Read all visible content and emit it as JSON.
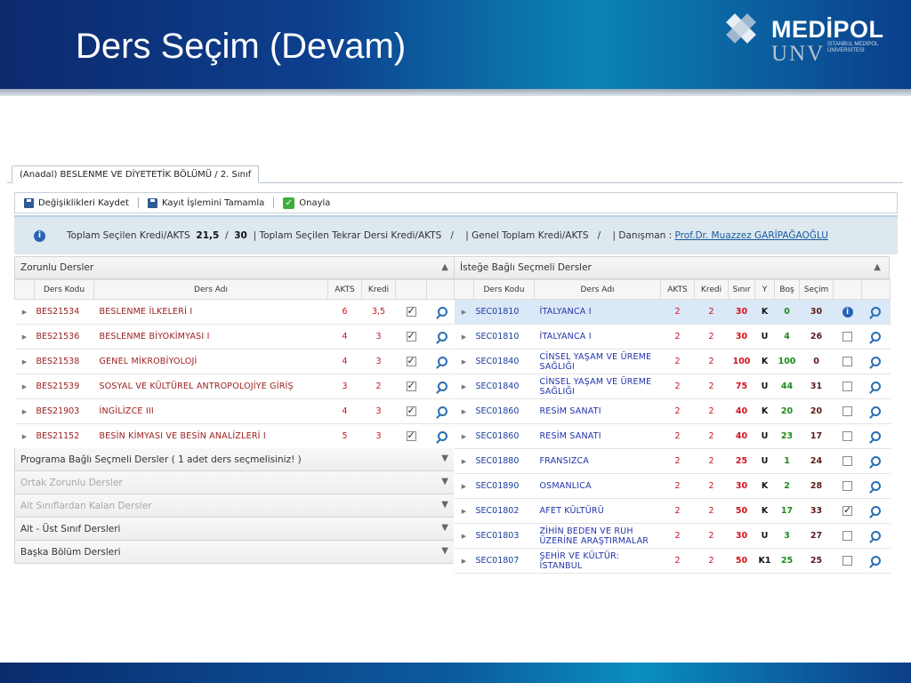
{
  "slide": {
    "title": "Ders Seçim (Devam)",
    "logo": {
      "name": "MEDİPOL",
      "unv": "UNV",
      "sub": "İSTANBUL MEDİPOL ÜNİVERSİTESİ"
    }
  },
  "app": {
    "tab_label": "(Anadal) BESLENME VE DİYETETİK BÖLÜMÜ / 2. Sınıf",
    "toolbar": {
      "save_label": "Değişiklikleri Kaydet",
      "complete_label": "Kayıt İşlemini Tamamla",
      "approve_label": "Onayla"
    },
    "info": {
      "total_label": "Toplam Seçilen Kredi/AKTS",
      "total_value": "21,5",
      "total_sep": "/",
      "total_max": "30",
      "repeat_label": "| Toplam Seçilen Tekrar Dersi Kredi/AKTS",
      "repeat_value": "/",
      "general_label": "| Genel Toplam Kredi/AKTS",
      "general_value": "/",
      "advisor_label": "| Danışman :",
      "advisor_name": "Prof.Dr. Muazzez GARİPAĞAOĞLU"
    },
    "mandatory": {
      "title": "Zorunlu Dersler",
      "headers": {
        "code": "Ders Kodu",
        "name": "Ders Adı",
        "akts": "AKTS",
        "kredi": "Kredi"
      },
      "rows": [
        {
          "code": "BES21534",
          "name": "BESLENME İLKELERİ I",
          "akts": "6",
          "kredi": "3,5"
        },
        {
          "code": "BES21536",
          "name": "BESLENME BİYOKİMYASI I",
          "akts": "4",
          "kredi": "3"
        },
        {
          "code": "BES21538",
          "name": "GENEL MİKROBİYOLOJİ",
          "akts": "4",
          "kredi": "3"
        },
        {
          "code": "BES21539",
          "name": "SOSYAL VE KÜLTÜREL ANTROPOLOJİYE GİRİŞ",
          "akts": "3",
          "kredi": "2"
        },
        {
          "code": "BES21903",
          "name": "İNGİLİZCE III",
          "akts": "4",
          "kredi": "3"
        },
        {
          "code": "BES21152",
          "name": "BESİN KİMYASI VE BESİN ANALİZLERİ I",
          "akts": "5",
          "kredi": "3"
        }
      ]
    },
    "accordions": [
      {
        "label": "Programa Bağlı Seçmeli Dersler ( 1 adet ders seçmelisiniz! )",
        "enabled": true
      },
      {
        "label": "Ortak Zorunlu Dersler",
        "enabled": false
      },
      {
        "label": "Alt Sınıflardan Kalan Dersler",
        "enabled": false
      },
      {
        "label": "Alt - Üst Sınıf Dersleri",
        "enabled": true
      },
      {
        "label": "Başka Bölüm Dersleri",
        "enabled": true
      }
    ],
    "elective": {
      "title": "İsteğe Bağlı Seçmeli Dersler",
      "headers": {
        "code": "Ders Kodu",
        "name": "Ders Adı",
        "akts": "AKTS",
        "kredi": "Kredi",
        "sinir": "Sınır",
        "y": "Y",
        "bos": "Boş",
        "secim": "Seçim"
      },
      "rows": [
        {
          "code": "SEC01810",
          "name": "İTALYANCA I",
          "akts": "2",
          "kredi": "2",
          "sinir": "30",
          "y": "K",
          "bos": "0",
          "secim": "30",
          "state": "info"
        },
        {
          "code": "SEC01810",
          "name": "İTALYANCA I",
          "akts": "2",
          "kredi": "2",
          "sinir": "30",
          "y": "U",
          "bos": "4",
          "secim": "26",
          "state": "off"
        },
        {
          "code": "SEC01840",
          "name": "CİNSEL YAŞAM VE ÜREME SAĞLIĞI",
          "akts": "2",
          "kredi": "2",
          "sinir": "100",
          "y": "K",
          "bos": "100",
          "secim": "0",
          "state": "off"
        },
        {
          "code": "SEC01840",
          "name": "CİNSEL YAŞAM VE ÜREME SAĞLIĞI",
          "akts": "2",
          "kredi": "2",
          "sinir": "75",
          "y": "U",
          "bos": "44",
          "secim": "31",
          "state": "off"
        },
        {
          "code": "SEC01860",
          "name": "RESİM SANATI",
          "akts": "2",
          "kredi": "2",
          "sinir": "40",
          "y": "K",
          "bos": "20",
          "secim": "20",
          "state": "off"
        },
        {
          "code": "SEC01860",
          "name": "RESİM SANATI",
          "akts": "2",
          "kredi": "2",
          "sinir": "40",
          "y": "U",
          "bos": "23",
          "secim": "17",
          "state": "off"
        },
        {
          "code": "SEC01880",
          "name": "FRANSIZCA",
          "akts": "2",
          "kredi": "2",
          "sinir": "25",
          "y": "U",
          "bos": "1",
          "secim": "24",
          "state": "off"
        },
        {
          "code": "SEC01890",
          "name": "OSMANLICA",
          "akts": "2",
          "kredi": "2",
          "sinir": "30",
          "y": "K",
          "bos": "2",
          "secim": "28",
          "state": "off"
        },
        {
          "code": "SEC01802",
          "name": "AFET KÜLTÜRÜ",
          "akts": "2",
          "kredi": "2",
          "sinir": "50",
          "y": "K",
          "bos": "17",
          "secim": "33",
          "state": "on"
        },
        {
          "code": "SEC01803",
          "name": "ZİHİN BEDEN VE RUH ÜZERİNE ARAŞTIRMALAR",
          "akts": "2",
          "kredi": "2",
          "sinir": "30",
          "y": "U",
          "bos": "3",
          "secim": "27",
          "state": "off"
        },
        {
          "code": "SEC01807",
          "name": "ŞEHİR VE KÜLTÜR: İSTANBUL",
          "akts": "2",
          "kredi": "2",
          "sinir": "50",
          "y": "K1",
          "bos": "25",
          "secim": "25",
          "state": "off"
        }
      ]
    }
  }
}
